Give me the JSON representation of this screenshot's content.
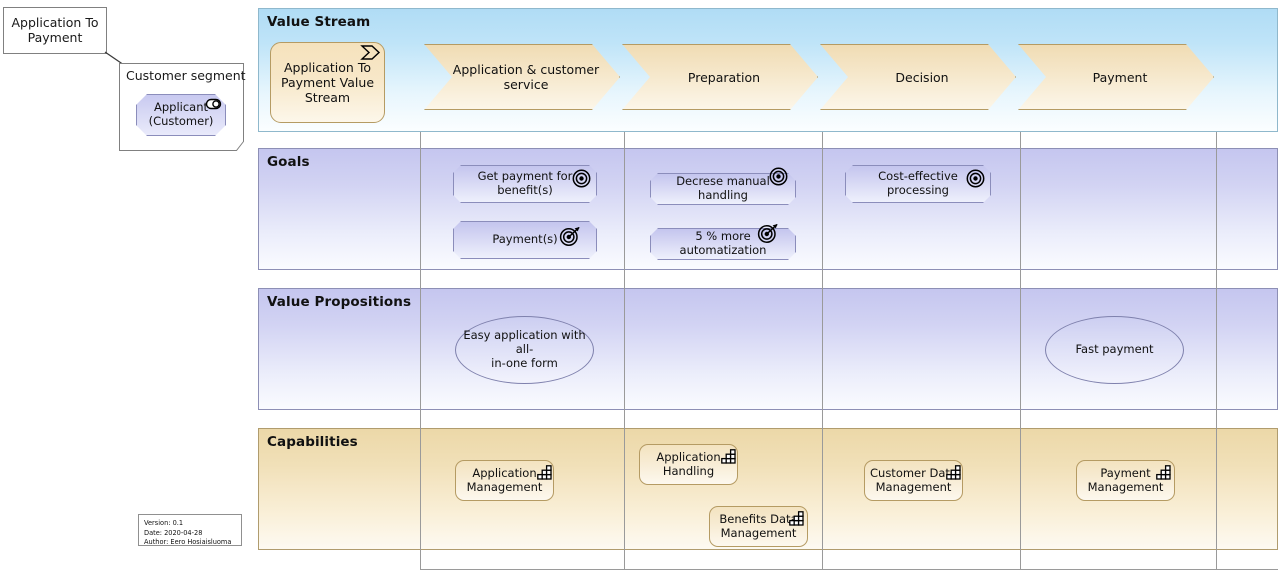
{
  "diagram": {
    "title_note": "Application To Payment",
    "customer_segment": {
      "title": "Customer segment",
      "actor": "Applicant\n(Customer)",
      "actor_line1": "Applicant",
      "actor_line2": "(Customer)",
      "actor_icon": "business-actor-icon"
    },
    "metadata": {
      "version": "Version: 0.1",
      "date": "Date: 2020-04-28",
      "author": "Author: Eero Hosiaisluoma"
    }
  },
  "columns": [
    {
      "key": "labels",
      "label": ""
    },
    {
      "key": "application_customer_service",
      "label": "Application & customer service"
    },
    {
      "key": "preparation",
      "label": "Preparation"
    },
    {
      "key": "decision",
      "label": "Decision"
    },
    {
      "key": "payment",
      "label": "Payment"
    },
    {
      "key": "spare",
      "label": ""
    }
  ],
  "rows": [
    {
      "key": "value_stream",
      "label": "Value Stream",
      "master": {
        "label_line1": "Application To",
        "label_line2": "Payment Value",
        "label_line3": "Stream",
        "icon": "value-stream-icon"
      },
      "stages": [
        {
          "label": "Application & customer service",
          "icon": "value-stream-stage-icon"
        },
        {
          "label": "Preparation",
          "icon": "value-stream-stage-icon"
        },
        {
          "label": "Decision",
          "icon": "value-stream-stage-icon"
        },
        {
          "label": "Payment",
          "icon": "value-stream-stage-icon"
        }
      ]
    },
    {
      "key": "goals",
      "label": "Goals",
      "items": [
        {
          "label_line1": "Get payment for",
          "label_line2": "benefit(s)",
          "icon": "goal-icon",
          "column": "application_customer_service"
        },
        {
          "label_line1": "Payment(s)",
          "label_line2": "",
          "icon": "outcome-icon",
          "column": "application_customer_service"
        },
        {
          "label_line1": "Decrese manual handling",
          "label_line2": "",
          "icon": "goal-icon",
          "column": "preparation"
        },
        {
          "label_line1": "5 % more automatization",
          "label_line2": "",
          "icon": "outcome-icon",
          "column": "preparation"
        },
        {
          "label_line1": "Cost-effective",
          "label_line2": "processing",
          "icon": "goal-icon",
          "column": "decision"
        }
      ]
    },
    {
      "key": "value_propositions",
      "label": "Value Propositions",
      "items": [
        {
          "label_line1": "Easy application with all-",
          "label_line2": "in-one form",
          "column": "application_customer_service"
        },
        {
          "label_line1": "Fast payment",
          "label_line2": "",
          "column": "payment"
        }
      ]
    },
    {
      "key": "capabilities",
      "label": "Capabilities",
      "items": [
        {
          "label_line1": "Application",
          "label_line2": "Management",
          "icon": "capability-icon",
          "column": "application_customer_service"
        },
        {
          "label_line1": "Application",
          "label_line2": "Handling",
          "icon": "capability-icon",
          "column": "preparation"
        },
        {
          "label_line1": "Benefits Data",
          "label_line2": "Management",
          "icon": "capability-icon",
          "column": "preparation"
        },
        {
          "label_line1": "Customer Data",
          "label_line2": "Management",
          "icon": "capability-icon",
          "column": "decision"
        },
        {
          "label_line1": "Payment",
          "label_line2": "Management",
          "icon": "capability-icon",
          "column": "payment"
        }
      ]
    }
  ],
  "colors": {
    "value_stream_band": "#b0dcf5",
    "motivation_band": "#c5c6ef",
    "capability_band": "#ecd8a8",
    "business_amber": "#f5e2bc",
    "motivation_purple": "#c8c9f0"
  }
}
